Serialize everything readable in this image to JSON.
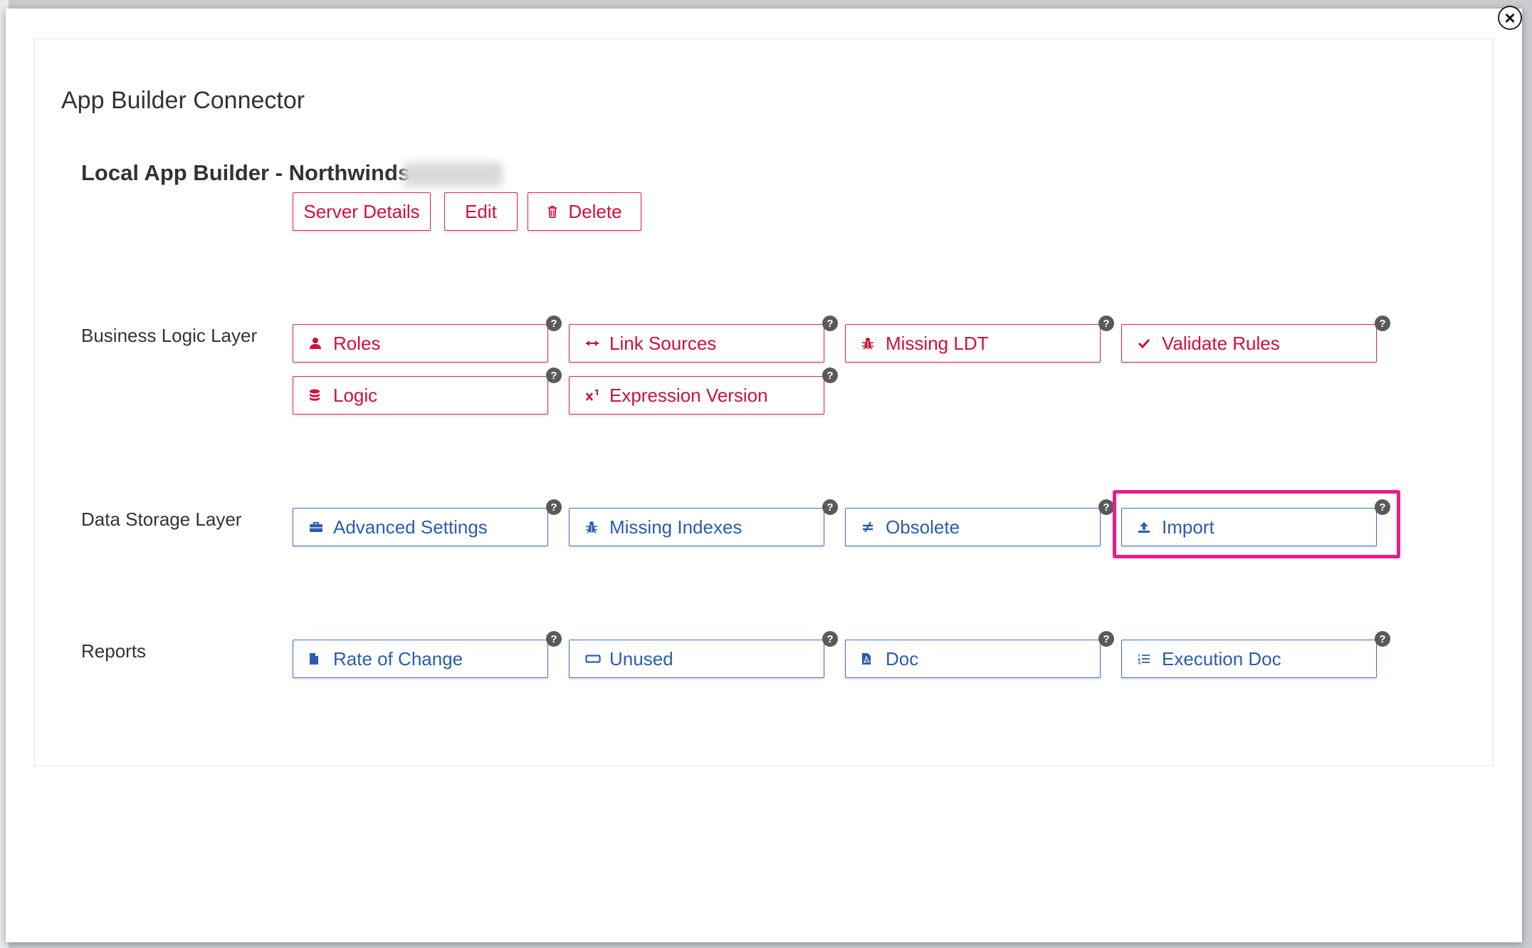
{
  "modal": {
    "title": "App Builder Connector",
    "close_icon": "close-icon",
    "connector_name": "Local App Builder - Northwinds"
  },
  "connector_actions": [
    {
      "label": "Server Details",
      "icon": "",
      "color": "#d0103a"
    },
    {
      "label": "Edit",
      "icon": "",
      "color": "#d0103a"
    },
    {
      "label": "Delete",
      "icon": "trash-icon",
      "color": "#d0103a"
    }
  ],
  "sections": [
    {
      "label": "Business Logic Layer",
      "color": "#d0103a",
      "buttons": [
        {
          "label": "Roles",
          "icon": "user-icon"
        },
        {
          "label": "Link Sources",
          "icon": "arrows-horizontal-icon"
        },
        {
          "label": "Missing LDT",
          "icon": "bug-icon"
        },
        {
          "label": "Validate Rules",
          "icon": "check-icon"
        },
        {
          "label": "Logic",
          "icon": "database-icon"
        },
        {
          "label": "Expression Version",
          "icon": "superscript-icon"
        }
      ]
    },
    {
      "label": "Data Storage Layer",
      "color": "#2a5db0",
      "buttons": [
        {
          "label": "Advanced Settings",
          "icon": "briefcase-icon"
        },
        {
          "label": "Missing Indexes",
          "icon": "bug-icon"
        },
        {
          "label": "Obsolete",
          "icon": "not-equal-icon"
        },
        {
          "label": "Import",
          "icon": "upload-icon",
          "highlighted": true
        }
      ]
    },
    {
      "label": "Reports",
      "color": "#2a5db0",
      "buttons": [
        {
          "label": "Rate of Change",
          "icon": "file-icon"
        },
        {
          "label": "Unused",
          "icon": "rectangle-icon"
        },
        {
          "label": "Doc",
          "icon": "file-pdf-icon"
        },
        {
          "label": "Execution Doc",
          "icon": "list-ol-icon"
        }
      ]
    }
  ],
  "help_icon": "question-circle-icon",
  "help_glyph": "?",
  "highlight_color": "#ee1a8c"
}
